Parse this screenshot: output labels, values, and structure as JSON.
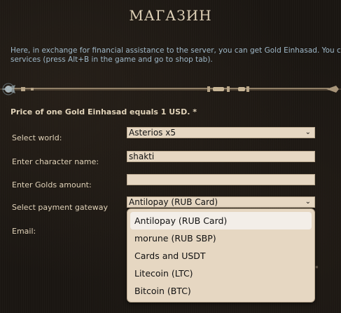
{
  "title": "МАГАЗИН",
  "intro_line1": "Here, in exchange for financial assistance to the server, you can get Gold Einhasad. You can use G",
  "intro_line2": "services (press Alt+B in the game and go to shop tab).",
  "price_note": "Price of one Gold Einhasad equals 1 USD. *",
  "form": {
    "world_label": "Select world:",
    "world_value": "Asterios x5",
    "character_label": "Enter character name:",
    "character_value": "shakti",
    "golds_label": "Enter Golds amount:",
    "golds_value": "",
    "gateway_label": "Select payment gateway",
    "gateway_value": "Antilopay (RUB Card)",
    "email_label": "Email:"
  },
  "gateway_options": [
    "Antilopay (RUB Card)",
    "morune (RUB SBP)",
    "Cards and USDT",
    "Litecoin (LTC)",
    "Bitcoin (BTC)"
  ],
  "selected_option_index": 0,
  "asterisk": "*",
  "icons": {
    "dropdown_chevron": "chevron-down-icon",
    "divider_ornament": "staff-ornament-icon"
  },
  "colors": {
    "background": "#1a1612",
    "field_bg": "#e6d7c2",
    "intro_text": "#9fb8c8",
    "label_text": "#e0d2b8"
  }
}
